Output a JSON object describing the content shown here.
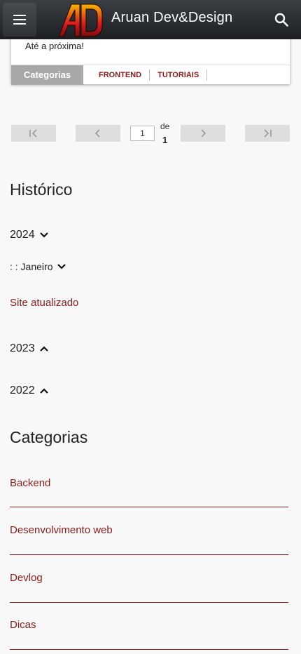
{
  "header": {
    "site_title": "Aruan Dev&Design",
    "logo_text": "AD",
    "menu_icon": "menu-icon",
    "search_icon": "search-icon",
    "colors": {
      "bar": "#1c1f22",
      "logo_red": "#d81e1e",
      "logo_yellow": "#f5b800"
    }
  },
  "post_card": {
    "text": "Até a próxima!",
    "categories_label": "Categorias",
    "categories": [
      "FRONTEND",
      "TUTORIAIS"
    ]
  },
  "pagination": {
    "current_page": "1",
    "of_label": "de",
    "total_pages": "1",
    "icons": [
      "first-page-icon",
      "prev-page-icon",
      "next-page-icon",
      "last-page-icon"
    ]
  },
  "history": {
    "title": "Histórico",
    "years": [
      {
        "label": "2024",
        "expanded": true
      },
      {
        "label": "2023",
        "expanded": false
      },
      {
        "label": "2022",
        "expanded": false
      }
    ],
    "month_label": ": : Janeiro",
    "post_title": "Site atualizado"
  },
  "categories": {
    "title": "Categorias",
    "items": [
      "Backend",
      "Desenvolvimento web",
      "Devlog",
      "Dicas"
    ]
  },
  "accent_color": "#8b1a1a"
}
